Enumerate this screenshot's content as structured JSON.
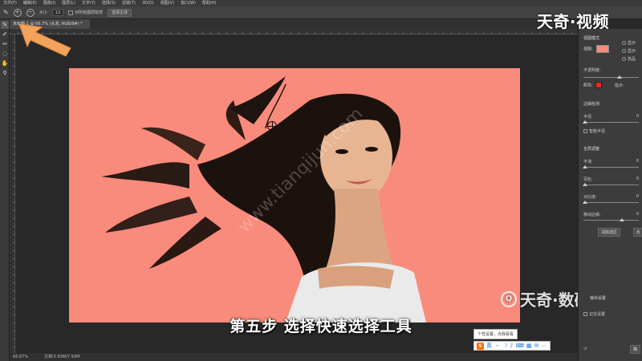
{
  "menubar": {
    "items": [
      "文件(F)",
      "编辑(E)",
      "图像(I)",
      "图层(L)",
      "文字(Y)",
      "选择(S)",
      "滤镜(T)",
      "3D(D)",
      "视图(V)",
      "窗口(W)",
      "帮助(H)"
    ]
  },
  "options_bar": {
    "size_label": "大小",
    "size_value": "13",
    "sample_all_layers": "对所有图层取样",
    "select_subject": "选择主体"
  },
  "logo_text": "天奇·视频",
  "document": {
    "tab_title": "未标题-1 @ 66.7% (头发, RGB/8#) *"
  },
  "subtitle": "第五步  选择快速选择工具",
  "watermarks": {
    "bottom_right": "天奇·数码",
    "bottom_right_icon": "Q",
    "diagonal": "www.tianqijun.com"
  },
  "tooltip": "个性设置，点我看看",
  "ime": {
    "logo": "S",
    "icons": [
      "英",
      "・",
      "☽",
      "♪",
      "⌨",
      "▦",
      "✉",
      "⋯"
    ]
  },
  "statusbar": {
    "zoom": "66.67%",
    "doc_info": "文档:5.93M/7.93M"
  },
  "panel": {
    "view_mode_label": "视图模式",
    "view_label": "视图:",
    "show_edge": "显示",
    "show_original": "显示",
    "high_quality": "高品",
    "opacity_label": "不透明度:",
    "color_label": "颜色:",
    "indicates_label": "指示:",
    "edge_detection": "边缘检测",
    "radius_label": "半径:",
    "radius_value": "0",
    "smart_radius": "智能半径",
    "global_refine": "全局调整",
    "smooth_label": "平滑:",
    "smooth_value": "0",
    "feather_label": "羽化:",
    "feather_value": "0",
    "contrast_label": "对比度:",
    "contrast_value": "0",
    "shift_edge_label": "移动边缘:",
    "shift_edge_value": "0",
    "clear_selection": "清除选区",
    "invert": "反",
    "output_settings": "输出设置",
    "remember_settings": "记住设置",
    "ok_label": "确"
  },
  "colors": {
    "canvas": "#f98b7c",
    "indicator_red": "#e8291c",
    "arrow_orange": "#f3a35c"
  }
}
